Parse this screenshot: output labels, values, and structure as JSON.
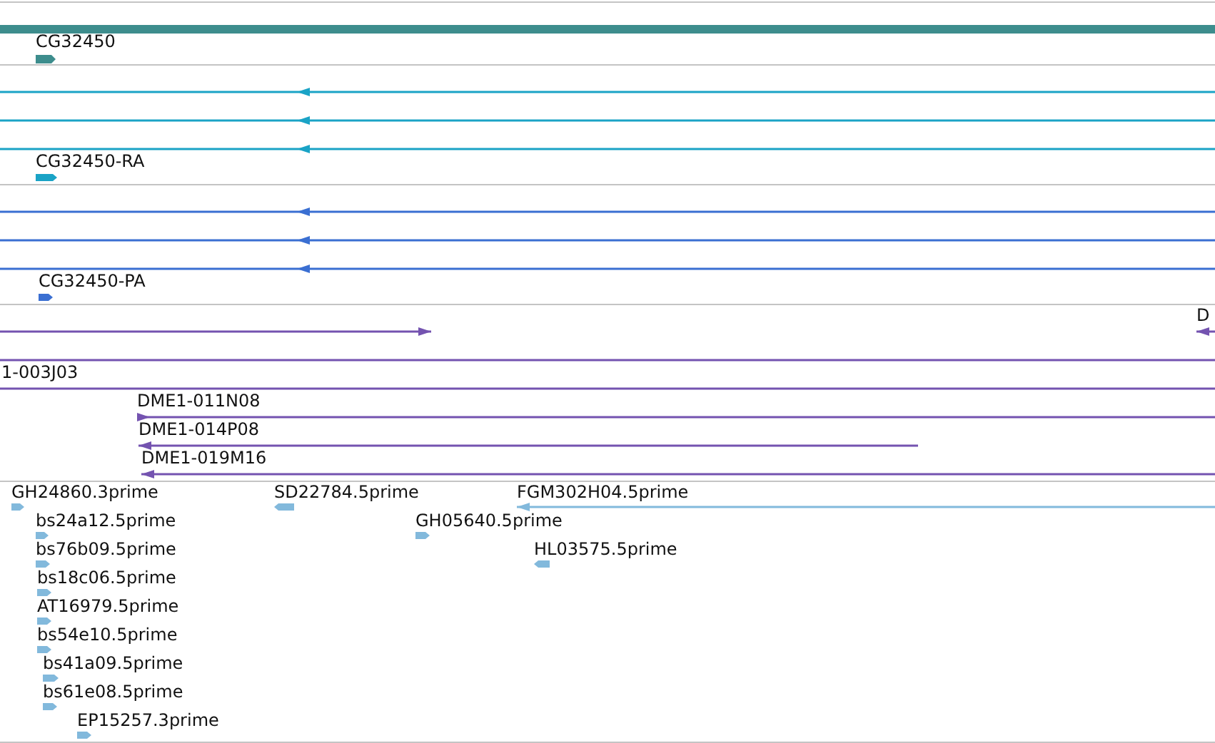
{
  "tracks": [
    {
      "kind": "gene",
      "color": "#3d8d8d",
      "features": [
        {
          "arrow": false
        },
        {
          "label": "CG32450",
          "reverse": false
        }
      ]
    },
    {
      "kind": "transcript",
      "color": "#1aa3c6",
      "features": [
        {
          "reverse": true
        },
        {
          "reverse": true
        },
        {
          "reverse": true
        },
        {
          "label": "CG32450-RA",
          "reverse": false
        }
      ]
    },
    {
      "kind": "transcript",
      "color": "#3a6fd2",
      "features": [
        {
          "reverse": true
        },
        {
          "reverse": true
        },
        {
          "reverse": true
        },
        {
          "label": "CG32450-PA",
          "reverse": false
        }
      ]
    },
    {
      "kind": "clone",
      "color": "#7453b0",
      "features": [
        {
          "reverse": false
        },
        {
          "label": "D",
          "reverse": true
        },
        {
          "arrow": false
        },
        {
          "label": "1-003J03",
          "arrow": false
        },
        {
          "label": "DME1-011N08",
          "reverse": false
        },
        {
          "label": "DME1-014P08",
          "reverse": true
        },
        {
          "label": "DME1-019M16",
          "reverse": true
        }
      ]
    },
    {
      "kind": "est",
      "color": "#82b9dc",
      "features": [
        {
          "label": "GH24860.3prime",
          "reverse": false
        },
        {
          "label": "bs24a12.5prime",
          "reverse": false
        },
        {
          "label": "bs76b09.5prime",
          "reverse": false
        },
        {
          "label": "bs18c06.5prime",
          "reverse": false
        },
        {
          "label": "AT16979.5prime",
          "reverse": false
        },
        {
          "label": "bs54e10.5prime",
          "reverse": false
        },
        {
          "label": "bs41a09.5prime",
          "reverse": false
        },
        {
          "label": "bs61e08.5prime",
          "reverse": false
        },
        {
          "label": "EP15257.3prime",
          "reverse": false
        },
        {
          "label": "SD22784.5prime",
          "reverse": true
        },
        {
          "label": "GH05640.5prime",
          "reverse": false
        },
        {
          "label": "FGM302H04.5prime",
          "reverse": true
        },
        {
          "label": "HL03575.5prime",
          "reverse": true
        }
      ]
    }
  ]
}
